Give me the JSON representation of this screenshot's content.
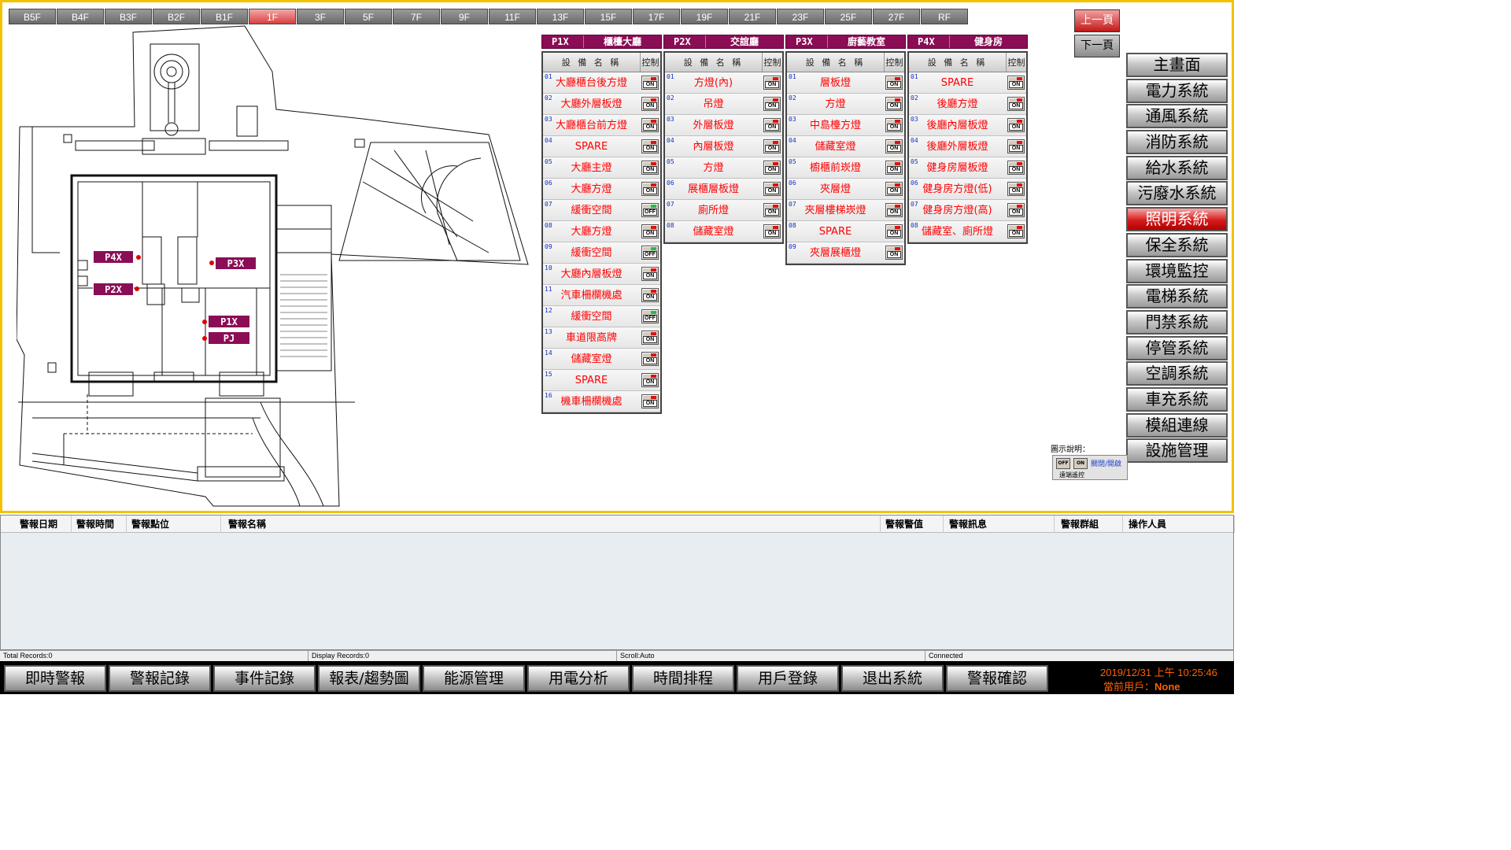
{
  "floors": [
    {
      "label": "B5F",
      "active": false
    },
    {
      "label": "B4F",
      "active": false
    },
    {
      "label": "B3F",
      "active": false
    },
    {
      "label": "B2F",
      "active": false
    },
    {
      "label": "B1F",
      "active": false
    },
    {
      "label": "1F",
      "active": true
    },
    {
      "label": "3F",
      "active": false
    },
    {
      "label": "5F",
      "active": false
    },
    {
      "label": "7F",
      "active": false
    },
    {
      "label": "9F",
      "active": false
    },
    {
      "label": "11F",
      "active": false
    },
    {
      "label": "13F",
      "active": false
    },
    {
      "label": "15F",
      "active": false
    },
    {
      "label": "17F",
      "active": false
    },
    {
      "label": "19F",
      "active": false
    },
    {
      "label": "21F",
      "active": false
    },
    {
      "label": "23F",
      "active": false
    },
    {
      "label": "25F",
      "active": false
    },
    {
      "label": "27F",
      "active": false
    },
    {
      "label": "RF",
      "active": false
    }
  ],
  "plan_tags": [
    "P4X",
    "P3X",
    "P2X",
    "P1X",
    "PJ"
  ],
  "panel_col_name": "設 備 名 稱",
  "panel_col_ctrl": "控制",
  "panels": [
    {
      "code": "P1X",
      "name": "櫃檯大廳",
      "rows": [
        {
          "num": "01",
          "name": "大廳櫃台後方燈",
          "state": "ON"
        },
        {
          "num": "02",
          "name": "大廳外層板燈",
          "state": "ON"
        },
        {
          "num": "03",
          "name": "大廳櫃台前方燈",
          "state": "ON"
        },
        {
          "num": "04",
          "name": "SPARE",
          "state": "ON"
        },
        {
          "num": "05",
          "name": "大廳主燈",
          "state": "ON"
        },
        {
          "num": "06",
          "name": "大廳方燈",
          "state": "ON"
        },
        {
          "num": "07",
          "name": "緩衝空間",
          "state": "OFF"
        },
        {
          "num": "08",
          "name": "大廳方燈",
          "state": "ON"
        },
        {
          "num": "09",
          "name": "緩衝空間",
          "state": "OFF"
        },
        {
          "num": "10",
          "name": "大廳內層板燈",
          "state": "ON"
        },
        {
          "num": "11",
          "name": "汽車柵欄機處",
          "state": "ON"
        },
        {
          "num": "12",
          "name": "緩衝空間",
          "state": "OFF"
        },
        {
          "num": "13",
          "name": "車道限高牌",
          "state": "ON"
        },
        {
          "num": "14",
          "name": "儲藏室燈",
          "state": "ON"
        },
        {
          "num": "15",
          "name": "SPARE",
          "state": "ON"
        },
        {
          "num": "16",
          "name": "機車柵欄機處",
          "state": "ON"
        }
      ]
    },
    {
      "code": "P2X",
      "name": "交誼廳",
      "rows": [
        {
          "num": "01",
          "name": "方燈(內)",
          "state": "ON"
        },
        {
          "num": "02",
          "name": "吊燈",
          "state": "ON"
        },
        {
          "num": "03",
          "name": "外層板燈",
          "state": "ON"
        },
        {
          "num": "04",
          "name": "內層板燈",
          "state": "ON"
        },
        {
          "num": "05",
          "name": "方燈",
          "state": "ON"
        },
        {
          "num": "06",
          "name": "展櫃層板燈",
          "state": "ON"
        },
        {
          "num": "07",
          "name": "廁所燈",
          "state": "ON"
        },
        {
          "num": "08",
          "name": "儲藏室燈",
          "state": "ON"
        }
      ]
    },
    {
      "code": "P3X",
      "name": "廚藝教室",
      "rows": [
        {
          "num": "01",
          "name": "層板燈",
          "state": "ON"
        },
        {
          "num": "02",
          "name": "方燈",
          "state": "ON"
        },
        {
          "num": "03",
          "name": "中島檯方燈",
          "state": "ON"
        },
        {
          "num": "04",
          "name": "儲藏室燈",
          "state": "ON"
        },
        {
          "num": "05",
          "name": "櫥櫃前崁燈",
          "state": "ON"
        },
        {
          "num": "06",
          "name": "夾層燈",
          "state": "ON"
        },
        {
          "num": "07",
          "name": "夾層樓梯崁燈",
          "state": "ON"
        },
        {
          "num": "08",
          "name": "SPARE",
          "state": "ON"
        },
        {
          "num": "09",
          "name": "夾層展櫃燈",
          "state": "ON"
        }
      ]
    },
    {
      "code": "P4X",
      "name": "健身房",
      "rows": [
        {
          "num": "01",
          "name": "SPARE",
          "state": "ON"
        },
        {
          "num": "02",
          "name": "後廳方燈",
          "state": "ON"
        },
        {
          "num": "03",
          "name": "後廳內層板燈",
          "state": "ON"
        },
        {
          "num": "04",
          "name": "後廳外層板燈",
          "state": "ON"
        },
        {
          "num": "05",
          "name": "健身房層板燈",
          "state": "ON"
        },
        {
          "num": "06",
          "name": "健身房方燈(低)",
          "state": "ON"
        },
        {
          "num": "07",
          "name": "健身房方燈(高)",
          "state": "ON"
        },
        {
          "num": "08",
          "name": "儲藏室、廁所燈",
          "state": "ON"
        }
      ]
    }
  ],
  "page_nav": {
    "prev": "上一頁",
    "next": "下一頁"
  },
  "systems": [
    {
      "label": "主畫面",
      "active": false
    },
    {
      "label": "電力系統",
      "active": false
    },
    {
      "label": "通風系統",
      "active": false
    },
    {
      "label": "消防系統",
      "active": false
    },
    {
      "label": "給水系統",
      "active": false
    },
    {
      "label": "污廢水系統",
      "active": false
    },
    {
      "label": "照明系統",
      "active": true
    },
    {
      "label": "保全系統",
      "active": false
    },
    {
      "label": "環境監控",
      "active": false
    },
    {
      "label": "電梯系統",
      "active": false
    },
    {
      "label": "門禁系統",
      "active": false
    },
    {
      "label": "停管系統",
      "active": false
    },
    {
      "label": "空調系統",
      "active": false
    },
    {
      "label": "車充系統",
      "active": false
    },
    {
      "label": "模組連線",
      "active": false
    },
    {
      "label": "設施管理",
      "active": false
    }
  ],
  "legend": {
    "title": "圖示說明：",
    "off": "OFF",
    "on": "ON",
    "text1": "關閉/開啟",
    "text2": "遠端遙控"
  },
  "alarm_columns": [
    "警報日期",
    "警報時間",
    "警報點位",
    "警報名稱",
    "警報警值",
    "警報訊息",
    "警報群組",
    "操作人員"
  ],
  "status": {
    "total": "Total Records:0",
    "display": "Display Records:0",
    "scroll": "Scroll:Auto",
    "conn": "Connected"
  },
  "bottom_buttons": [
    "即時警報",
    "警報記錄",
    "事件記錄",
    "報表/趨勢圖",
    "能源管理",
    "用電分析",
    "時間排程",
    "用戶登錄",
    "退出系統",
    "警報確認"
  ],
  "clock": "2019/12/31 上午 10:25:46",
  "user_label": "當前用戶：",
  "user_name": "None",
  "colors": {
    "accent": "#8b0d56",
    "active_red": "#d61c1c",
    "frame": "#f2c200",
    "off_lamp": "#20c040",
    "on_lamp": "#e01010"
  }
}
